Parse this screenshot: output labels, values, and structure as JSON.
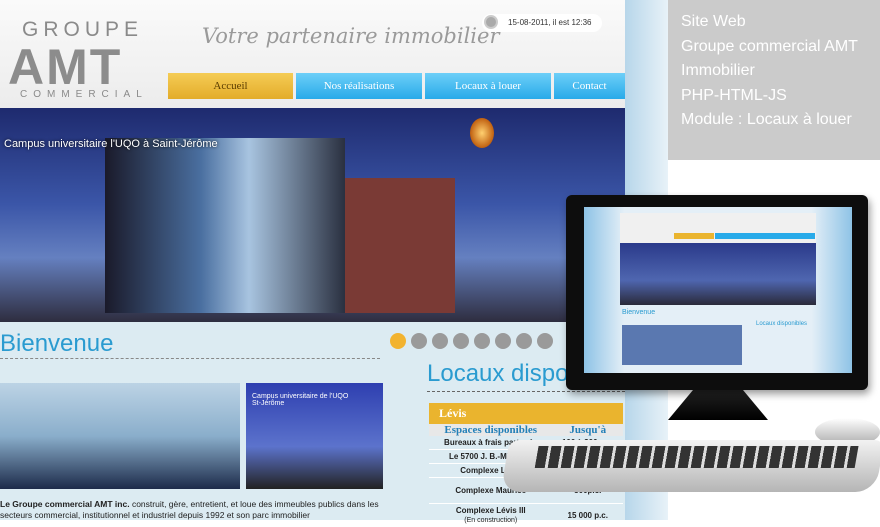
{
  "site": {
    "logo": {
      "top": "GROUPE",
      "main": "AMT",
      "bottom": "COMMERCIAL"
    },
    "tagline": "Votre partenaire immobilier",
    "datetime": "15-08-2011, il est 12:36",
    "nav": [
      "Accueil",
      "Nos réalisations",
      "Locaux à louer",
      "Contact"
    ],
    "banner_caption": "Campus universitaire l'UQO à Saint-Jérôme",
    "welcome": "Bienvenue",
    "thumb_caption": "Campus universitaire de l'UQO St-Jérôme",
    "paragraph_bold": "Le Groupe commercial AMT inc.",
    "paragraph": " construit, gère, entretient, et loue des immeubles publics dans les secteurs commercial, institutionnel et industriel depuis 1992 et son parc immobilier",
    "locaux_title": "Locaux disponibles",
    "table": {
      "city": "Lévis",
      "headers": [
        "Espaces disponibles",
        "Jusqu'à"
      ],
      "rows": [
        [
          "Bureaux à frais partagés",
          "100 à 300 p.c."
        ],
        [
          "Le 5700 J. B.-Michaud",
          ""
        ],
        [
          "Complexe Lévis",
          ""
        ],
        [
          "Complexe Maurice",
          ""
        ],
        [
          "Complexe Lévis III",
          "15 000 p.c."
        ]
      ],
      "row5_note": "(En construction)",
      "row4_partial": "500p.c."
    }
  },
  "info": [
    "Site Web",
    "Groupe commercial AMT",
    "Immobilier",
    "PHP-HTML-JS",
    "Module : Locaux à louer"
  ],
  "monitor": {
    "welcome": "Bienvenue",
    "locaux": "Locaux disponibles"
  },
  "colors": {
    "accent_blue": "#2a9bd0",
    "gold": "#eab42e",
    "nav_blue": "#28aae9"
  }
}
